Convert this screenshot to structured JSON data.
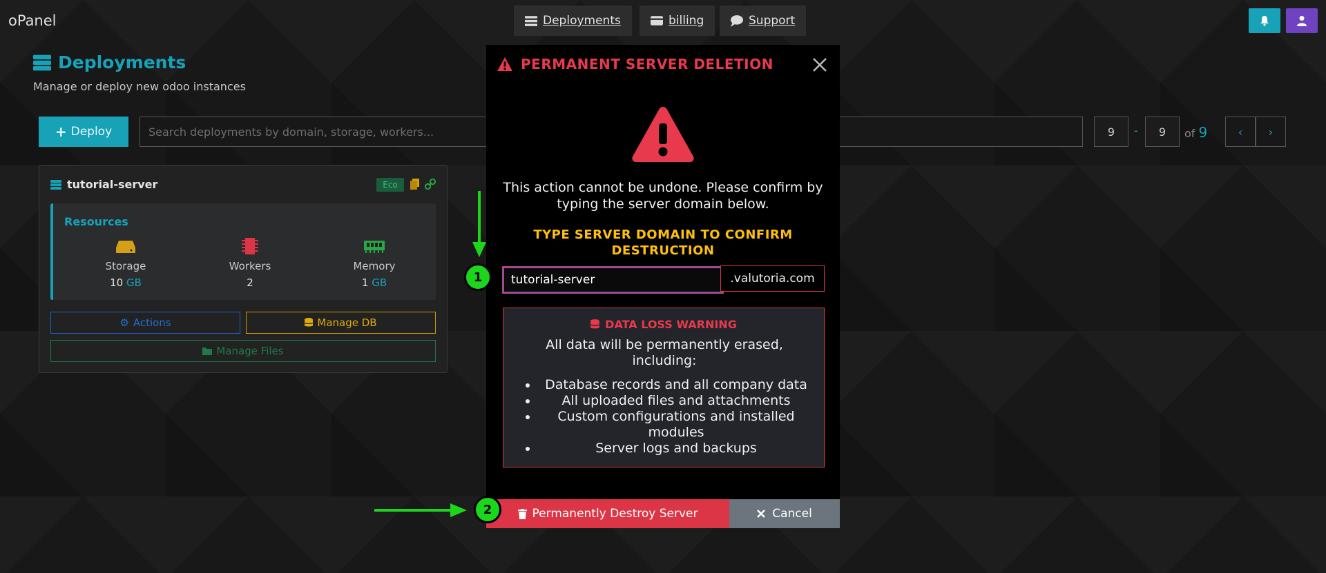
{
  "nav": {
    "brand": "oPanel",
    "items": [
      {
        "label": "Deployments"
      },
      {
        "label": "billing"
      },
      {
        "label": "Support"
      }
    ]
  },
  "page": {
    "title": "Deployments",
    "subtitle": "Manage or deploy new odoo instances"
  },
  "toolbar": {
    "deploy_label": "Deploy",
    "search_placeholder": "Search deployments by domain, storage, workers...",
    "page_from": "9",
    "page_sep": "-",
    "page_to": "9",
    "of_label": "of",
    "total": "9"
  },
  "card": {
    "name": "tutorial-server",
    "badge": "Eco",
    "resources_title": "Resources",
    "stats": [
      {
        "label": "Storage",
        "value": "10",
        "unit": "GB"
      },
      {
        "label": "Workers",
        "value": "2",
        "unit": ""
      },
      {
        "label": "Memory",
        "value": "1",
        "unit": "GB"
      }
    ],
    "actions_label": "Actions",
    "manage_db_label": "Manage DB",
    "manage_files_label": "Manage Files"
  },
  "modal": {
    "title": "PERMANENT SERVER DELETION",
    "message": "This action cannot be undone. Please confirm by typing the server domain below.",
    "confirm_label": "TYPE SERVER DOMAIN TO CONFIRM DESTRUCTION",
    "domain_value": "tutorial-server",
    "domain_suffix": ".valutoria.com",
    "warning_title": "DATA LOSS WARNING",
    "warning_text": "All data will be permanently erased, including:",
    "warning_items": [
      "Database records and all company data",
      "All uploaded files and attachments",
      "Custom configurations and installed modules",
      "Server logs and backups"
    ],
    "destroy_label": "Permanently Destroy Server",
    "cancel_label": "Cancel"
  },
  "annotations": {
    "step1": "1",
    "step2": "2"
  },
  "colors": {
    "accent": "#17a2b8",
    "danger": "#dc3545",
    "warning": "#ffc107",
    "success": "#28a745",
    "secondary": "#6c757d",
    "purple": "#6f42c1",
    "marker": "#1bd61b"
  }
}
